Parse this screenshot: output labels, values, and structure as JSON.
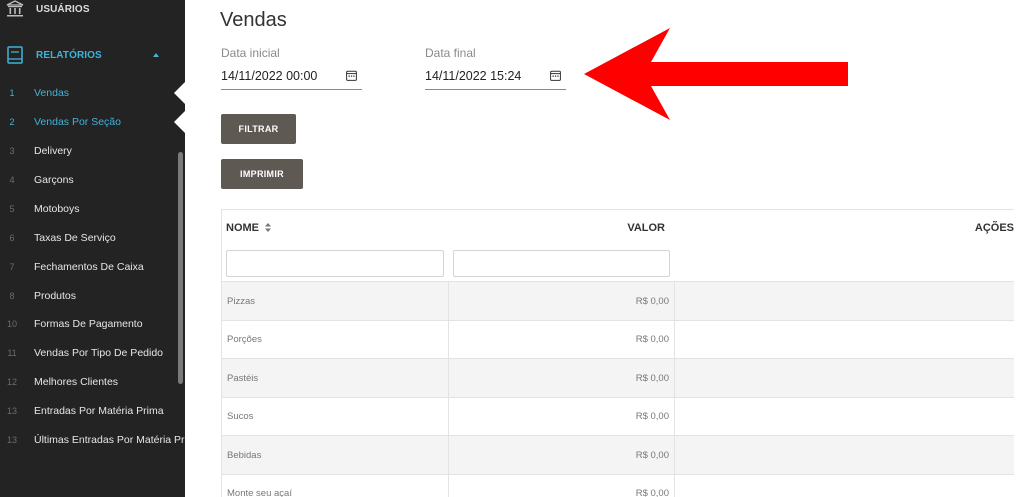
{
  "sidebar": {
    "users_label": "USUÁRIOS",
    "reports_label": "RELATÓRIOS",
    "items": [
      {
        "num": "1",
        "label": "Vendas",
        "active": true
      },
      {
        "num": "2",
        "label": "Vendas Por Seção",
        "active": true
      },
      {
        "num": "3",
        "label": "Delivery"
      },
      {
        "num": "4",
        "label": "Garçons"
      },
      {
        "num": "5",
        "label": "Motoboys"
      },
      {
        "num": "6",
        "label": "Taxas De Serviço"
      },
      {
        "num": "7",
        "label": "Fechamentos De Caixa"
      },
      {
        "num": "8",
        "label": "Produtos"
      },
      {
        "num": "10",
        "label": "Formas De Pagamento"
      },
      {
        "num": "11",
        "label": "Vendas Por Tipo De Pedido"
      },
      {
        "num": "12",
        "label": "Melhores Clientes"
      },
      {
        "num": "13",
        "label": "Entradas Por Matéria Prima"
      },
      {
        "num": "13",
        "label": "Últimas Entradas Por Matéria Pr"
      }
    ]
  },
  "page": {
    "title": "Vendas",
    "start_label": "Data inicial",
    "start_value": "14/11/2022 00:00",
    "end_label": "Data final",
    "end_value": "14/11/2022 15:24",
    "filter_button": "FILTRAR",
    "print_button": "IMPRIMIR"
  },
  "table": {
    "col_name": "NOME",
    "col_value": "VALOR",
    "col_actions": "AÇÕES",
    "rows": [
      {
        "name": "Pizzas",
        "value": "R$ 0,00"
      },
      {
        "name": "Porções",
        "value": "R$ 0,00"
      },
      {
        "name": "Pastéis",
        "value": "R$ 0,00"
      },
      {
        "name": "Sucos",
        "value": "R$ 0,00"
      },
      {
        "name": "Bebidas",
        "value": "R$ 0,00"
      },
      {
        "name": "Monte seu açaí",
        "value": "R$ 0,00"
      }
    ]
  },
  "colors": {
    "sidebar_bg": "#232323",
    "accent": "#3fb3d9",
    "button_bg": "#5e5953",
    "annotation_arrow": "#ff0000"
  }
}
